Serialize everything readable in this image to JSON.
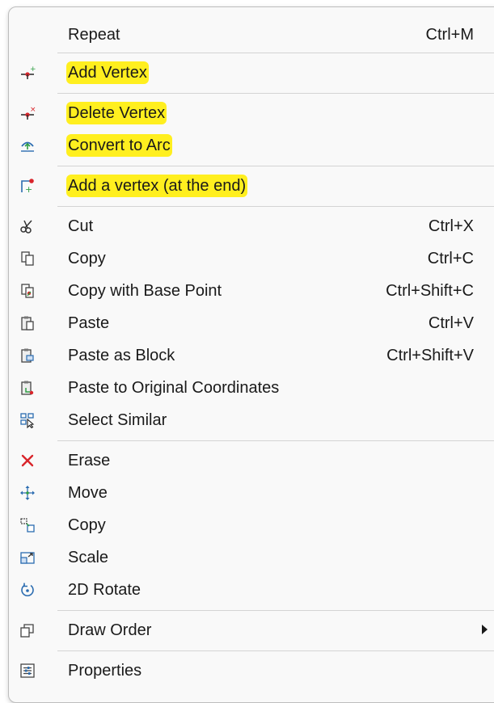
{
  "menu": {
    "items": [
      {
        "name": "menu-item-repeat",
        "icon": "",
        "label": "Repeat",
        "shortcut": "Ctrl+M"
      },
      {
        "name": "menu-item-add-vertex",
        "icon": "add-vertex-icon",
        "label": "Add Vertex",
        "shortcut": "",
        "highlighted": true
      },
      {
        "name": "menu-item-delete-vertex",
        "icon": "delete-vertex-icon",
        "label": "Delete Vertex",
        "shortcut": "",
        "highlighted": true
      },
      {
        "name": "menu-item-convert-to-arc",
        "icon": "convert-to-arc-icon",
        "label": "Convert to Arc",
        "shortcut": "",
        "highlighted": true
      },
      {
        "name": "menu-item-add-vertex-end",
        "icon": "add-vertex-end-icon",
        "label": "Add a vertex (at the end)",
        "shortcut": "",
        "highlighted": true
      },
      {
        "name": "menu-item-cut",
        "icon": "scissors-icon",
        "label": "Cut",
        "shortcut": "Ctrl+X"
      },
      {
        "name": "menu-item-copy",
        "icon": "copy-icon",
        "label": "Copy",
        "shortcut": "Ctrl+C"
      },
      {
        "name": "menu-item-copy-base-point",
        "icon": "copy-base-point-icon",
        "label": "Copy with Base Point",
        "shortcut": "Ctrl+Shift+C"
      },
      {
        "name": "menu-item-paste",
        "icon": "paste-icon",
        "label": "Paste",
        "shortcut": "Ctrl+V"
      },
      {
        "name": "menu-item-paste-as-block",
        "icon": "paste-block-icon",
        "label": "Paste as Block",
        "shortcut": "Ctrl+Shift+V"
      },
      {
        "name": "menu-item-paste-original",
        "icon": "paste-original-icon",
        "label": "Paste to Original Coordinates",
        "shortcut": ""
      },
      {
        "name": "menu-item-select-similar",
        "icon": "select-similar-icon",
        "label": "Select Similar",
        "shortcut": ""
      },
      {
        "name": "menu-item-erase",
        "icon": "erase-icon",
        "label": "Erase",
        "shortcut": ""
      },
      {
        "name": "menu-item-move",
        "icon": "move-icon",
        "label": "Move",
        "shortcut": ""
      },
      {
        "name": "menu-item-copy-object",
        "icon": "copy-object-icon",
        "label": "Copy",
        "shortcut": ""
      },
      {
        "name": "menu-item-scale",
        "icon": "scale-icon",
        "label": "Scale",
        "shortcut": ""
      },
      {
        "name": "menu-item-2d-rotate",
        "icon": "rotate-icon",
        "label": "2D Rotate",
        "shortcut": ""
      },
      {
        "name": "menu-item-draw-order",
        "icon": "draw-order-icon",
        "label": "Draw Order",
        "shortcut": "",
        "submenu": true
      },
      {
        "name": "menu-item-properties",
        "icon": "properties-icon",
        "label": "Properties",
        "shortcut": ""
      }
    ]
  },
  "colors": {
    "highlight": "#ffef1f",
    "erase": "#d9252b",
    "accent": "#2b6cb0"
  }
}
